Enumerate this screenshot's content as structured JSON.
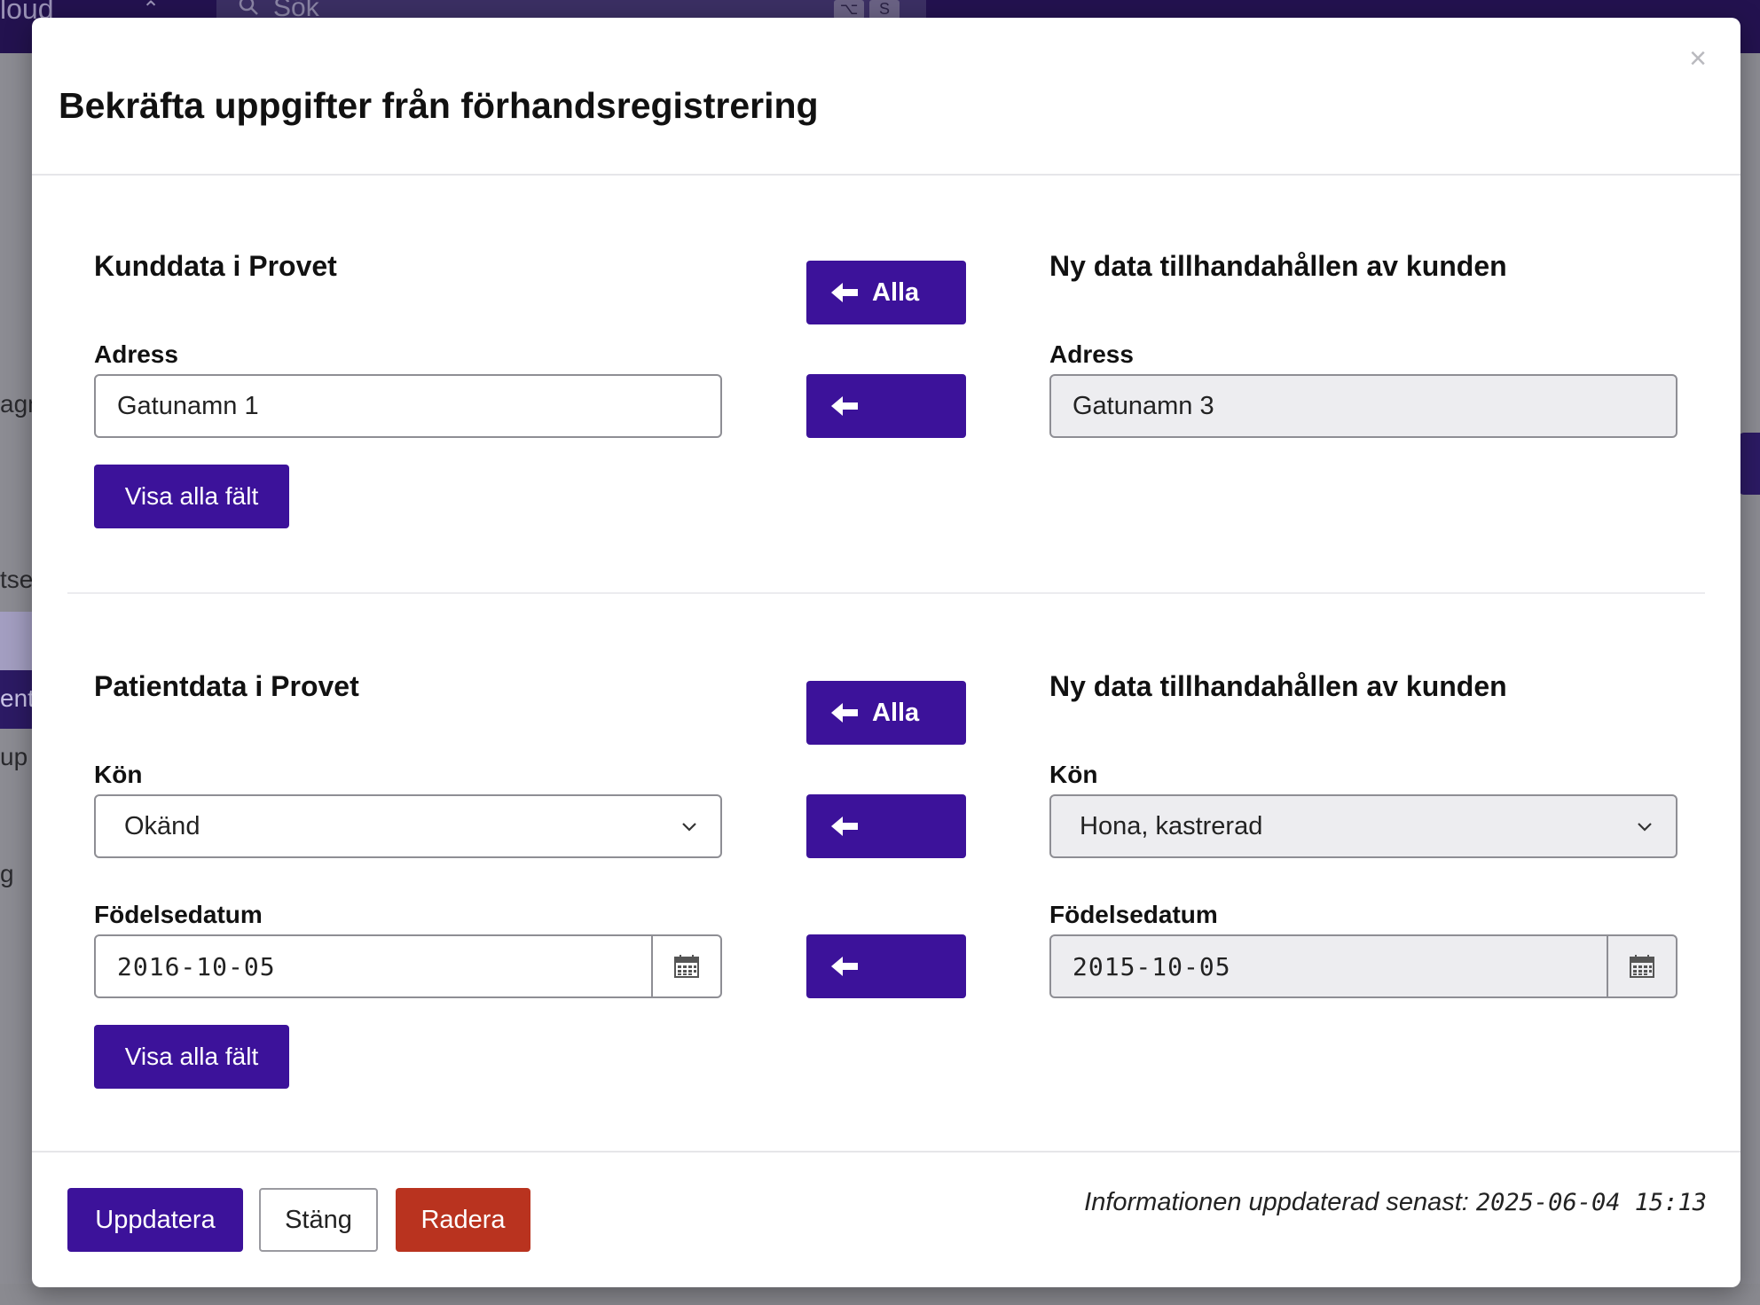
{
  "background": {
    "brand": "loud",
    "search_placeholder": "Sök",
    "kbd_1": "⌥",
    "kbd_2": "S",
    "left_snippets": [
      "agn",
      "tse",
      "ent",
      "up",
      "g"
    ]
  },
  "modal": {
    "title": "Bekräfta uppgifter från förhandsregistrering",
    "close_symbol": "×",
    "customer_section": {
      "left_heading": "Kunddata i Provet",
      "right_heading": "Ny data tillhandahållen av kunden",
      "all_label": "Alla",
      "address_label": "Adress",
      "address_current": "Gatunamn 1",
      "address_new": "Gatunamn 3",
      "show_all_label": "Visa alla fält"
    },
    "patient_section": {
      "left_heading": "Patientdata i Provet",
      "right_heading": "Ny data tillhandahållen av kunden",
      "all_label": "Alla",
      "sex_label": "Kön",
      "sex_current": "Okänd",
      "sex_new": "Hona, kastrerad",
      "birthdate_label": "Födelsedatum",
      "birthdate_current": "2016-10-05",
      "birthdate_new": "2015-10-05",
      "show_all_label": "Visa alla fält"
    },
    "footer": {
      "update_label": "Uppdatera",
      "close_label": "Stäng",
      "delete_label": "Radera",
      "info_prefix": "Informationen uppdaterad senast:",
      "info_timestamp": "2025-06-04 15:13"
    }
  },
  "colors": {
    "primary": "#3c129a",
    "danger": "#b9331f",
    "topbar": "#23124f"
  }
}
